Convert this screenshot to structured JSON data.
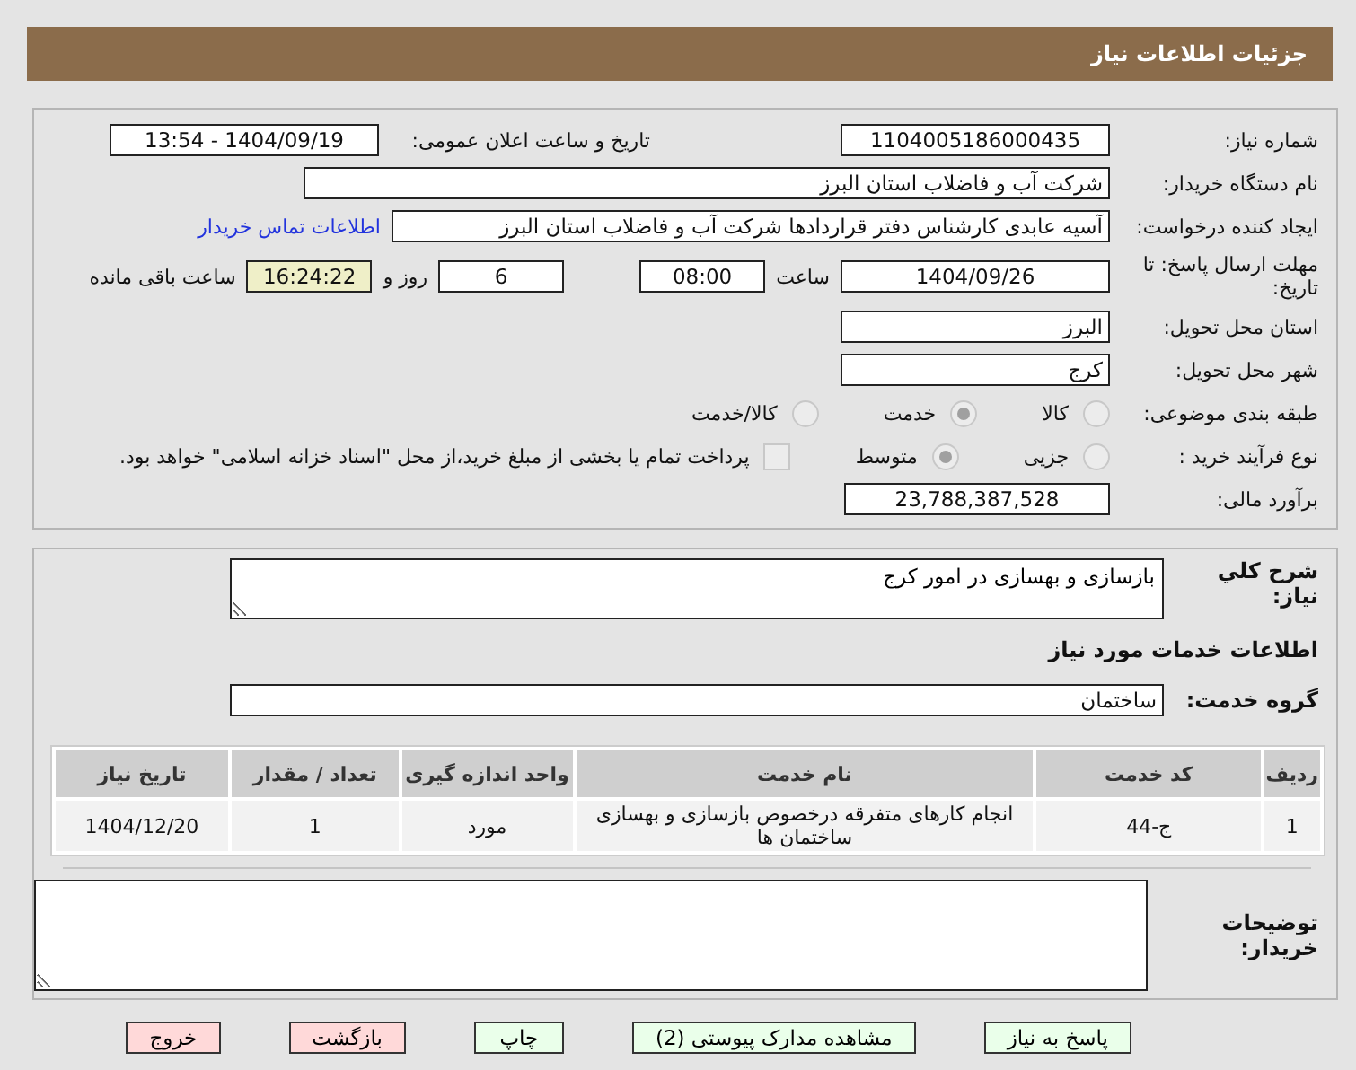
{
  "header": {
    "title": "جزئیات اطلاعات نیاز"
  },
  "need_number": {
    "label": "شماره نیاز:",
    "value": "1104005186000435"
  },
  "announce": {
    "label": "تاریخ و ساعت اعلان عمومی:",
    "value": "1404/09/19 - 13:54"
  },
  "buyer": {
    "label": "نام دستگاه خریدار:",
    "value": "شرکت آب و فاضلاب استان البرز"
  },
  "creator": {
    "label": "ایجاد کننده درخواست:",
    "value": "آسیه عابدی کارشناس دفتر قراردادها شرکت آب و فاضلاب استان البرز",
    "link": "اطلاعات تماس خریدار"
  },
  "deadline": {
    "label": "مهلت ارسال پاسخ: تا تاریخ:",
    "date": "1404/09/26",
    "time_label": "ساعت",
    "time": "08:00",
    "days": "6",
    "days_label": "روز و",
    "remaining": "16:24:22",
    "remaining_label": "ساعت باقی مانده"
  },
  "province": {
    "label": "استان محل تحویل:",
    "value": "البرز"
  },
  "city": {
    "label": "شهر محل تحویل:",
    "value": "کرج"
  },
  "category": {
    "label": "طبقه بندی موضوعی:",
    "options": [
      {
        "label": "کالا",
        "selected": false
      },
      {
        "label": "خدمت",
        "selected": true
      },
      {
        "label": "کالا/خدمت",
        "selected": false
      }
    ]
  },
  "process": {
    "label": "نوع فرآیند خرید :",
    "options": [
      {
        "label": "جزیی",
        "selected": false
      },
      {
        "label": "متوسط",
        "selected": true
      }
    ],
    "payment": {
      "checked": false,
      "text": "پرداخت تمام یا بخشی از مبلغ خرید،از محل \"اسناد خزانه اسلامی\" خواهد بود."
    }
  },
  "budget": {
    "label": "برآورد مالی:",
    "value": "23,788,387,528"
  },
  "description": {
    "label": "شرح کلي نياز:",
    "value": "بازسازی و بهسازی در امور کرج"
  },
  "services_heading": "اطلاعات خدمات مورد نیاز",
  "service_group": {
    "label": "گروه خدمت:",
    "value": "ساختمان"
  },
  "table": {
    "columns": [
      "ردیف",
      "کد خدمت",
      "نام خدمت",
      "واحد اندازه گیری",
      "تعداد / مقدار",
      "تاریخ نیاز"
    ],
    "rows": [
      [
        "1",
        "ج-44",
        "انجام کارهای متفرقه درخصوص بازسازی و بهسازی ساختمان ها",
        "مورد",
        "1",
        "1404/12/20"
      ]
    ]
  },
  "buyer_notes": {
    "label": "توضیحات خریدار:"
  },
  "buttons": [
    {
      "label": "پاسخ به نیاز",
      "kind": "action"
    },
    {
      "label": "مشاهده مدارک پیوستی (2)",
      "kind": "action"
    },
    {
      "label": "چاپ",
      "kind": "action"
    },
    {
      "label": "بازگشت",
      "kind": "exit"
    },
    {
      "label": "خروج",
      "kind": "exit"
    }
  ]
}
